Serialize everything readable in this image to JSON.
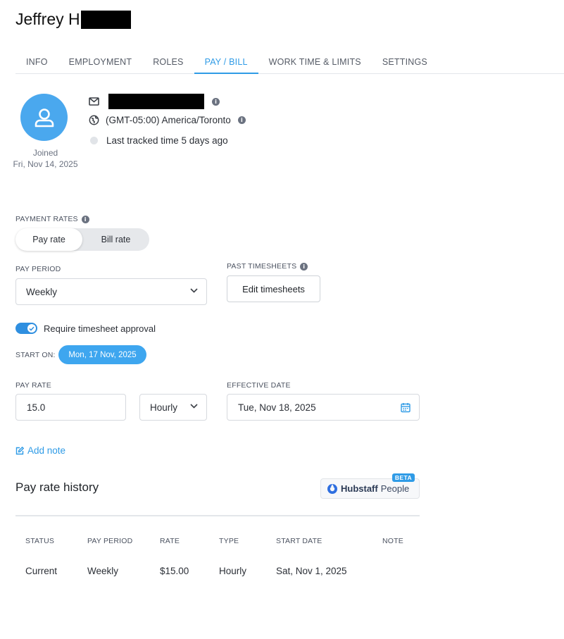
{
  "header": {
    "title": "Jeffrey H"
  },
  "tabs": [
    {
      "label": "INFO",
      "active": false
    },
    {
      "label": "EMPLOYMENT",
      "active": false
    },
    {
      "label": "ROLES",
      "active": false
    },
    {
      "label": "PAY / BILL",
      "active": true
    },
    {
      "label": "WORK TIME & LIMITS",
      "active": false
    },
    {
      "label": "SETTINGS",
      "active": false
    }
  ],
  "profile": {
    "avatar_icon": "user-icon",
    "joined_label": "Joined",
    "joined_date": "Fri, Nov 14, 2025",
    "timezone": "(GMT-05:00) America/Toronto",
    "last_tracked": "Last tracked time 5 days ago"
  },
  "payment_rates": {
    "label": "PAYMENT RATES",
    "options": [
      "Pay rate",
      "Bill rate"
    ],
    "selected": "Pay rate"
  },
  "pay_period": {
    "label": "PAY PERIOD",
    "value": "Weekly"
  },
  "past_timesheets": {
    "label": "PAST TIMESHEETS",
    "button": "Edit timesheets"
  },
  "approval": {
    "label": "Require timesheet approval",
    "enabled": true
  },
  "start_on": {
    "label": "START ON:",
    "value": "Mon, 17 Nov, 2025"
  },
  "pay_rate": {
    "label": "PAY RATE",
    "value": "15.0",
    "type": "Hourly"
  },
  "effective_date": {
    "label": "EFFECTIVE DATE",
    "value": "Tue, Nov 18, 2025"
  },
  "add_note": "Add note",
  "history": {
    "title": "Pay rate history",
    "brand_name": "Hubstaff",
    "brand_product": "People",
    "badge": "BETA",
    "columns": [
      "STATUS",
      "PAY PERIOD",
      "RATE",
      "TYPE",
      "START DATE",
      "NOTE"
    ],
    "rows": [
      [
        "Current",
        "Weekly",
        "$15.00",
        "Hourly",
        "Sat, Nov 1, 2025",
        ""
      ]
    ]
  },
  "colors": {
    "accent": "#2f9be6",
    "toggle": "#2f8fe0",
    "avatar": "#4aa8ee"
  }
}
